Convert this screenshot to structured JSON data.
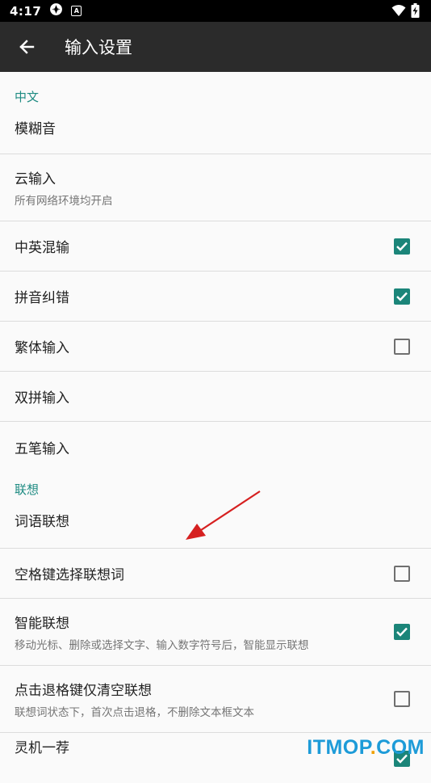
{
  "status_bar": {
    "time": "4:17",
    "icons": [
      "pinwheel-icon",
      "a-badge-icon",
      "wifi-icon",
      "battery-charging-icon"
    ],
    "badge_letter": "A"
  },
  "toolbar": {
    "back_icon": "arrow-left-icon",
    "title": "输入设置"
  },
  "sections": [
    {
      "header": "中文",
      "items": [
        {
          "title": "模糊音",
          "summary": "",
          "checkbox": null
        },
        {
          "title": "云输入",
          "summary": "所有网络环境均开启",
          "checkbox": null
        },
        {
          "title": "中英混输",
          "summary": "",
          "checkbox": true
        },
        {
          "title": "拼音纠错",
          "summary": "",
          "checkbox": true
        },
        {
          "title": "繁体输入",
          "summary": "",
          "checkbox": false
        },
        {
          "title": "双拼输入",
          "summary": "",
          "checkbox": null
        },
        {
          "title": "五笔输入",
          "summary": "",
          "checkbox": null
        }
      ]
    },
    {
      "header": "联想",
      "items": [
        {
          "title": "词语联想",
          "summary": "",
          "checkbox": null
        },
        {
          "title": "空格键选择联想词",
          "summary": "",
          "checkbox": false
        },
        {
          "title": "智能联想",
          "summary": "移动光标、删除或选择文字、输入数字符号后，智能显示联想",
          "checkbox": true
        },
        {
          "title": "点击退格键仅清空联想",
          "summary": "联想词状态下，首次点击退格，不删除文本框文本",
          "checkbox": false
        },
        {
          "title": "灵机一荐",
          "summary": "",
          "checkbox": true
        }
      ]
    }
  ],
  "colors": {
    "accent": "#1b8579",
    "section_header": "#1e8b82",
    "toolbar": "#2b2b2b",
    "annotation_arrow": "#d62020"
  },
  "watermark": {
    "prefix": "ITMOP",
    "dot": ".",
    "suffix": "COM"
  }
}
